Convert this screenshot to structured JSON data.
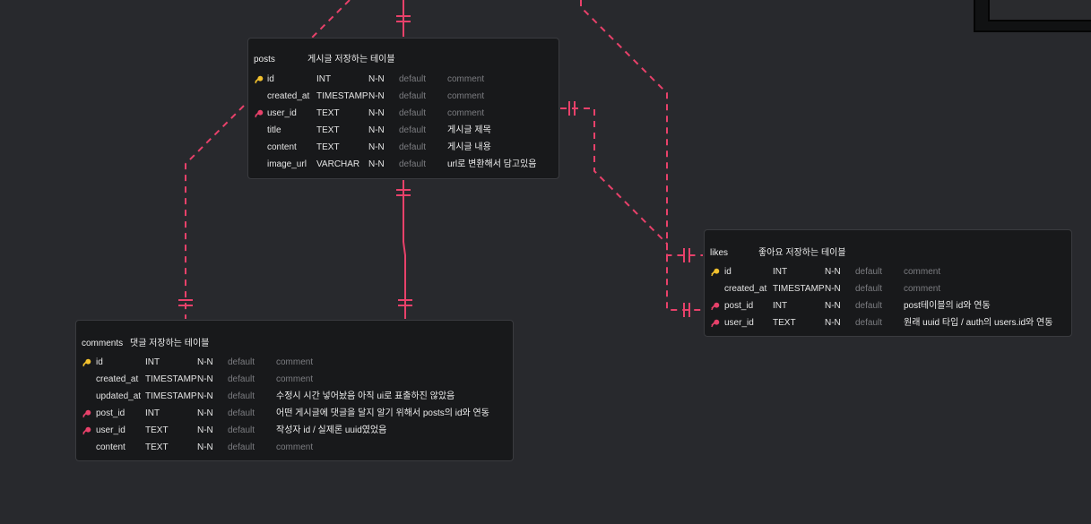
{
  "colors": {
    "background": "#28292d",
    "table_bg": "#18191b",
    "relation_line": "#e8416a",
    "primary_key": "#f2c12e",
    "foreign_key": "#e8416a"
  },
  "tables": {
    "posts": {
      "name": "posts",
      "comment": "게시글 저장하는 테이블",
      "columns": [
        {
          "name": "id",
          "type": "INT",
          "nullability": "N-N",
          "default": "default",
          "comment": "comment",
          "key": "primary",
          "comment_placeholder": true
        },
        {
          "name": "created_at",
          "type": "TIMESTAMP",
          "nullability": "N-N",
          "default": "default",
          "comment": "comment",
          "key": "none",
          "comment_placeholder": true
        },
        {
          "name": "user_id",
          "type": "TEXT",
          "nullability": "N-N",
          "default": "default",
          "comment": "comment",
          "key": "foreign",
          "comment_placeholder": true
        },
        {
          "name": "title",
          "type": "TEXT",
          "nullability": "N-N",
          "default": "default",
          "comment": "게시글 제목",
          "key": "none",
          "comment_placeholder": false
        },
        {
          "name": "content",
          "type": "TEXT",
          "nullability": "N-N",
          "default": "default",
          "comment": "게시글 내용",
          "key": "none",
          "comment_placeholder": false
        },
        {
          "name": "image_url",
          "type": "VARCHAR",
          "nullability": "N-N",
          "default": "default",
          "comment": "url로 변환해서 담고있음",
          "key": "none",
          "comment_placeholder": false
        }
      ]
    },
    "comments": {
      "name": "comments",
      "comment": "댓글 저장하는 테이블",
      "columns": [
        {
          "name": "id",
          "type": "INT",
          "nullability": "N-N",
          "default": "default",
          "comment": "comment",
          "key": "primary",
          "comment_placeholder": true
        },
        {
          "name": "created_at",
          "type": "TIMESTAMP",
          "nullability": "N-N",
          "default": "default",
          "comment": "comment",
          "key": "none",
          "comment_placeholder": true
        },
        {
          "name": "updated_at",
          "type": "TIMESTAMP",
          "nullability": "N-N",
          "default": "default",
          "comment": "수정시 시간 넣어놨음 아직 ui로 표출하진 않았음",
          "key": "none",
          "comment_placeholder": false
        },
        {
          "name": "post_id",
          "type": "INT",
          "nullability": "N-N",
          "default": "default",
          "comment": "어떤 게시글에 댓글을 달지 알기 위해서 posts의 id와 연동",
          "key": "foreign",
          "comment_placeholder": false
        },
        {
          "name": "user_id",
          "type": "TEXT",
          "nullability": "N-N",
          "default": "default",
          "comment": "작성자 id / 실제론 uuid였었음",
          "key": "foreign",
          "comment_placeholder": false
        },
        {
          "name": "content",
          "type": "TEXT",
          "nullability": "N-N",
          "default": "default",
          "comment": "comment",
          "key": "none",
          "comment_placeholder": true
        }
      ]
    },
    "likes": {
      "name": "likes",
      "comment": "좋아요 저장하는 테이블",
      "columns": [
        {
          "name": "id",
          "type": "INT",
          "nullability": "N-N",
          "default": "default",
          "comment": "comment",
          "key": "primary",
          "comment_placeholder": true
        },
        {
          "name": "created_at",
          "type": "TIMESTAMP",
          "nullability": "N-N",
          "default": "default",
          "comment": "comment",
          "key": "none",
          "comment_placeholder": true
        },
        {
          "name": "post_id",
          "type": "INT",
          "nullability": "N-N",
          "default": "default",
          "comment": "post테이블의 id와 연동",
          "key": "foreign",
          "comment_placeholder": false
        },
        {
          "name": "user_id",
          "type": "TEXT",
          "nullability": "N-N",
          "default": "default",
          "comment": "원래 uuid 타입 / auth의 users.id와 연동",
          "key": "foreign",
          "comment_placeholder": false
        }
      ]
    }
  }
}
